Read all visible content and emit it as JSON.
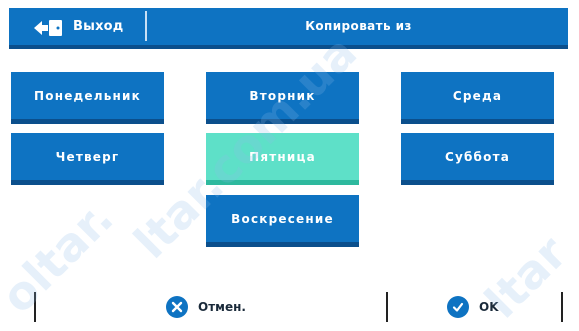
{
  "header": {
    "back_label": "Выход",
    "title": "Копировать из"
  },
  "days": [
    {
      "label": "Понедельник",
      "selected": false
    },
    {
      "label": "Вторник",
      "selected": false
    },
    {
      "label": "Среда",
      "selected": false
    },
    {
      "label": "Четверг",
      "selected": false
    },
    {
      "label": "Пятница",
      "selected": true
    },
    {
      "label": "Суббота",
      "selected": false
    },
    {
      "label": "Воскресение",
      "selected": false
    }
  ],
  "footer": {
    "cancel_label": "Отмен.",
    "ok_label": "OK"
  },
  "watermark": [
    "oltar.",
    "ltar.com.ua",
    "ltar"
  ],
  "colors": {
    "primary": "#0e73c2",
    "primary_shadow": "#0b4f8c",
    "selected": "#5ee0c8"
  }
}
